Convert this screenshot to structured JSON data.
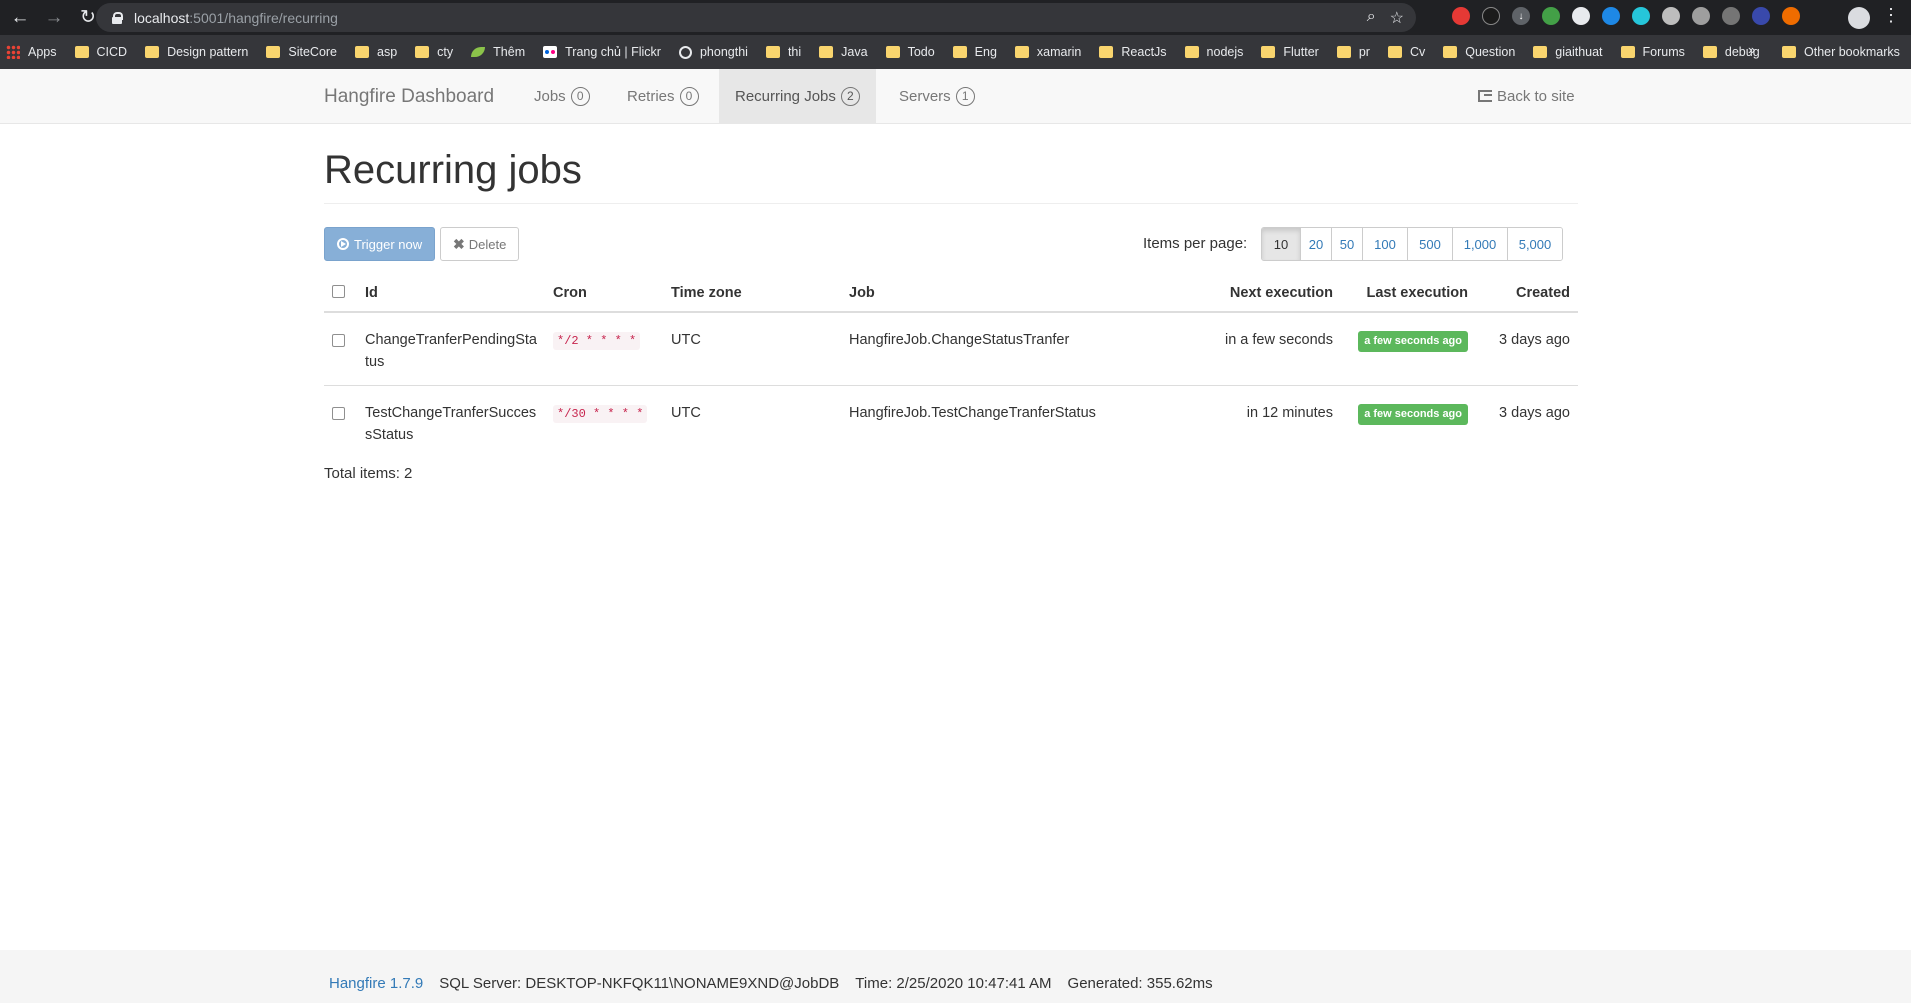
{
  "browser": {
    "url_host": "localhost",
    "url_path": ":5001/hangfire/recurring",
    "bookmarks": [
      "Apps",
      "CICD",
      "Design pattern",
      "SiteCore",
      "asp",
      "cty",
      "Thêm",
      "Trang chủ | Flickr",
      "phongthi",
      "thi",
      "Java",
      "Todo",
      "Eng",
      "xamarin",
      "ReactJs",
      "nodejs",
      "Flutter",
      "pr",
      "Cv",
      "Question",
      "giaithuat",
      "Forums",
      "debug"
    ],
    "more_label": "»",
    "other_bookmarks": "Other bookmarks"
  },
  "navbar": {
    "brand": "Hangfire Dashboard",
    "items": [
      {
        "label": "Jobs",
        "count": "0"
      },
      {
        "label": "Retries",
        "count": "0"
      },
      {
        "label": "Recurring Jobs",
        "count": "2"
      },
      {
        "label": "Servers",
        "count": "1"
      }
    ],
    "back": "Back to site"
  },
  "main": {
    "title": "Recurring jobs",
    "trigger_label": "Trigger now",
    "delete_label": "Delete",
    "items_per_page_label": "Items per page:",
    "page_sizes": [
      "10",
      "20",
      "50",
      "100",
      "500",
      "1,000",
      "5,000"
    ],
    "selected_page_size": "10",
    "columns": [
      "Id",
      "Cron",
      "Time zone",
      "Job",
      "Next execution",
      "Last execution",
      "Created"
    ],
    "rows": [
      {
        "id": "ChangeTranferPendingStatus",
        "cron": "*/2 * * * *",
        "tz": "UTC",
        "job": "HangfireJob.ChangeStatusTranfer",
        "next": "in a few seconds",
        "last": "a few seconds ago",
        "created": "3 days ago"
      },
      {
        "id": "TestChangeTranferSuccessStatus",
        "cron": "*/30 * * * *",
        "tz": "UTC",
        "job": "HangfireJob.TestChangeTranferStatus",
        "next": "in 12 minutes",
        "last": "a few seconds ago",
        "created": "3 days ago"
      }
    ],
    "total": "Total items: 2"
  },
  "footer": {
    "version": "Hangfire 1.7.9",
    "storage": "SQL Server: DESKTOP-NKFQK11\\NONAME9XND@JobDB",
    "time": "Time: 2/25/2020 10:47:41 AM",
    "generated": "Generated: 355.62ms"
  },
  "colors": {
    "success": "#5cb85c",
    "link": "#337ab7",
    "primary_btn": "#87afd7"
  }
}
